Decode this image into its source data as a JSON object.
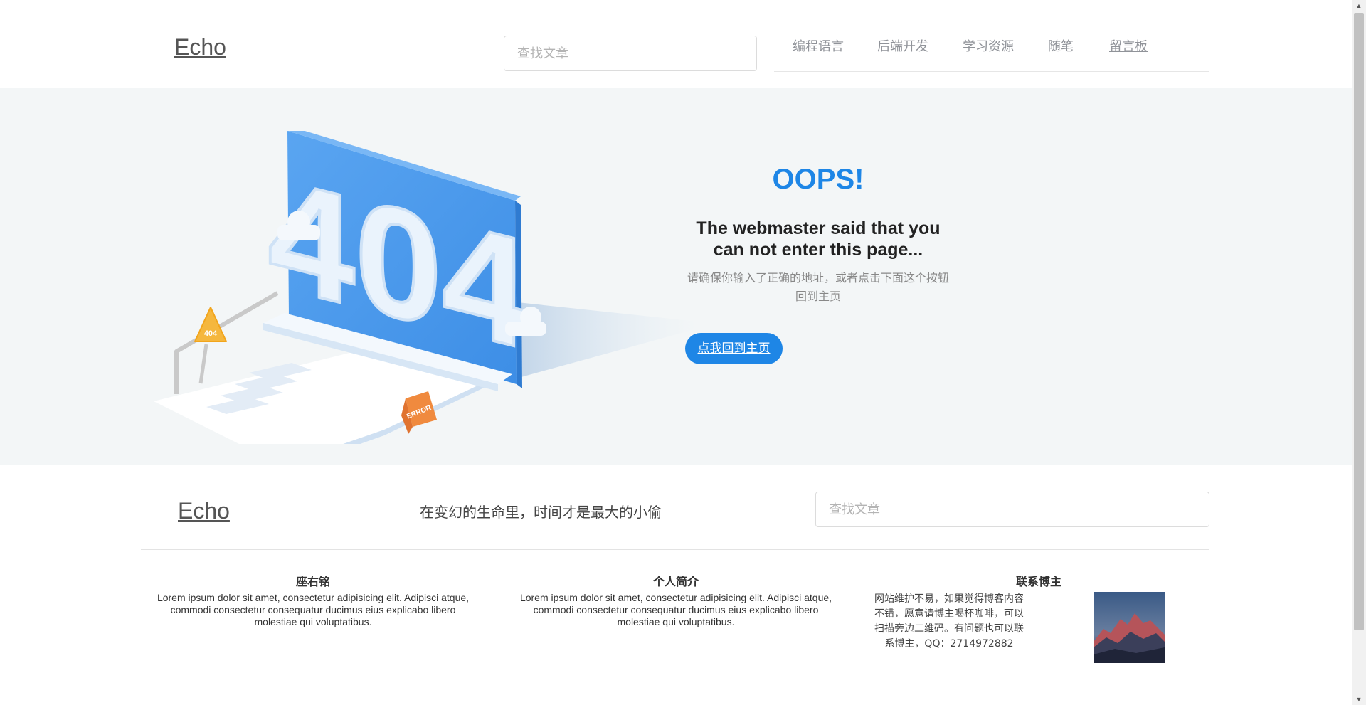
{
  "header": {
    "logo": "Echo",
    "search_placeholder": "查找文章",
    "nav": [
      "编程语言",
      "后端开发",
      "学习资源",
      "随笔",
      "留言板"
    ]
  },
  "hero": {
    "illustration": {
      "big_text": "404",
      "sign_text": "404",
      "board_text": "ERROR"
    },
    "oops": "OOPS!",
    "headline_line1": "The webmaster said that you",
    "headline_line2": "can not enter this page...",
    "info_line1": "请确保你输入了正确的地址，或者点击下面这个按钮",
    "info_line2": "回到主页",
    "button": "点我回到主页",
    "colors": {
      "accent": "#1e86e6",
      "background": "#f3f6f7"
    }
  },
  "footer": {
    "logo": "Echo",
    "motto": "在变幻的生命里，时间才是最大的小偷",
    "search_placeholder": "查找文章",
    "columns": [
      {
        "title": "座右铭",
        "lines": [
          "Lorem ipsum dolor sit amet, consectetur adipisicing elit. Adipisci atque,",
          "commodi consectetur consequatur ducimus eius explicabo libero",
          "molestiae qui voluptatibus."
        ]
      },
      {
        "title": "个人简介",
        "lines": [
          "Lorem ipsum dolor sit amet, consectetur adipisicing elit. Adipisci atque,",
          "commodi consectetur consequatur ducimus eius explicabo libero",
          "molestiae qui voluptatibus."
        ]
      },
      {
        "title": "联系博主",
        "lines": [
          "网站维护不易，如果觉得博客内容",
          "不错，愿意请博主喝杯咖啡，可以",
          "扫描旁边二维码。有问题也可以联",
          "系博主，QQ：2714972882"
        ]
      }
    ],
    "qr_image": "mountain-photo"
  }
}
